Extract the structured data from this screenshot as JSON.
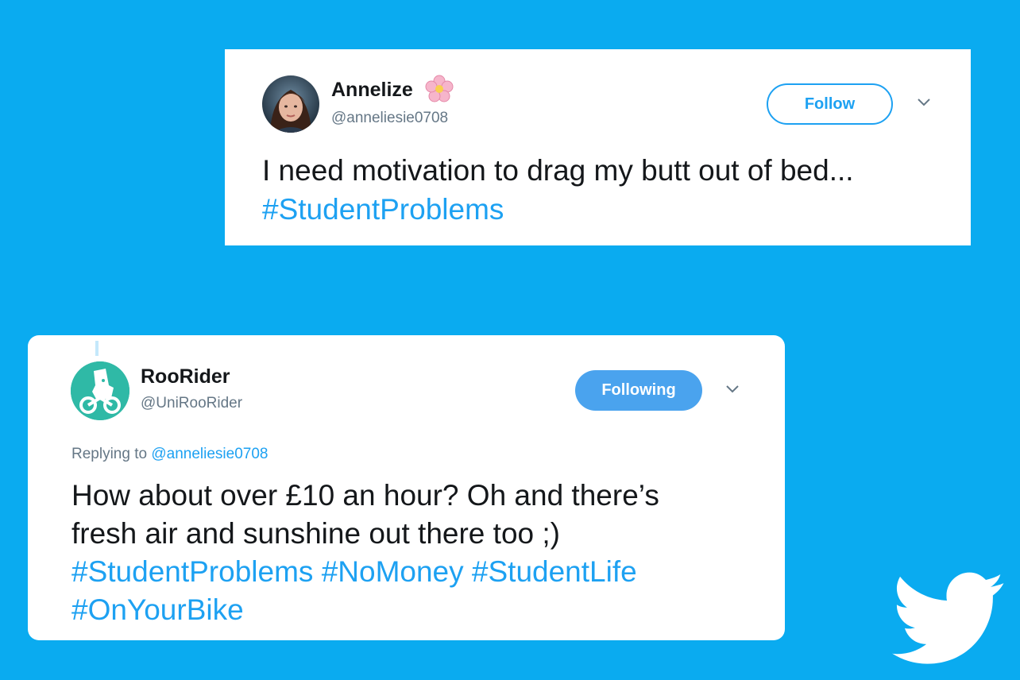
{
  "tweet1": {
    "name": "Annelize",
    "name_emoji_icon": "cherry-blossom-icon",
    "handle": "@anneliesie0708",
    "follow_label": "Follow",
    "text": "I need motivation to drag my butt out of bed...",
    "hashtag": "#StudentProblems"
  },
  "tweet2": {
    "name": "RooRider",
    "handle": "@UniRooRider",
    "follow_label": "Following",
    "replying_prefix": "Replying to",
    "replying_handle": "@anneliesie0708",
    "text_line1": "How about over £10 an hour? Oh and there’s",
    "text_line2": "fresh air and sunshine out there too ;)",
    "hashtags": [
      "#StudentProblems",
      "#NoMoney",
      "#StudentLife",
      "#OnYourBike"
    ]
  },
  "colors": {
    "background": "#0aabf0",
    "twitter_blue": "#1da1f2",
    "following_button": "#4aa3ee",
    "deliveroo_teal": "#2fb9a6",
    "secondary_text": "#657786"
  },
  "icons": [
    "chevron-down-icon",
    "twitter-bird-icon",
    "deliveroo-logo-icon"
  ]
}
